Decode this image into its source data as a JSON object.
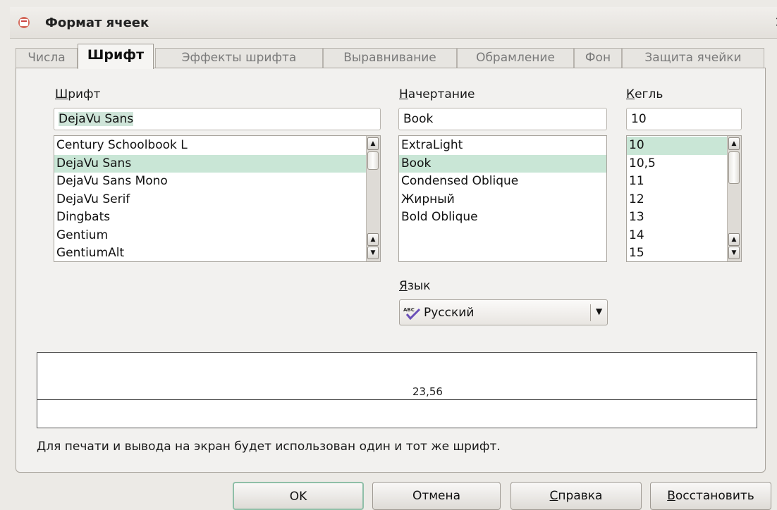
{
  "window": {
    "title": "Формат ячеек",
    "close_label": "×"
  },
  "tabs": [
    {
      "label": "Числа",
      "active": false
    },
    {
      "label": "Шрифт",
      "active": true
    },
    {
      "label": "Эффекты шрифта",
      "active": false
    },
    {
      "label": "Выравнивание",
      "active": false
    },
    {
      "label": "Обрамление",
      "active": false
    },
    {
      "label": "Фон",
      "active": false
    },
    {
      "label": "Защита ячейки",
      "active": false
    }
  ],
  "font": {
    "label_first": "Ш",
    "label_rest": "рифт",
    "value": "DejaVu Sans",
    "items": [
      "Century Schoolbook L",
      "DejaVu Sans",
      "DejaVu Sans Mono",
      "DejaVu Serif",
      "Dingbats",
      "Gentium",
      "GentiumAlt"
    ],
    "selected": "DejaVu Sans"
  },
  "style": {
    "label_first": "Н",
    "label_rest": "ачертание",
    "value": "Book",
    "items": [
      "ExtraLight",
      "Book",
      "Condensed Oblique",
      "Жирный",
      "Bold Oblique"
    ],
    "selected": "Book"
  },
  "size": {
    "label_first": "К",
    "label_rest": "егль",
    "value": "10",
    "items": [
      "10",
      "10,5",
      "11",
      "12",
      "13",
      "14",
      "15"
    ],
    "selected": "10"
  },
  "language": {
    "label_first": "Я",
    "label_rest": "зык",
    "value": "Русский",
    "icon": "spellcheck-abc-icon"
  },
  "preview": {
    "text": "23,56",
    "info": "Для печати и вывода на экран будет использован один и тот же шрифт."
  },
  "buttons": {
    "ok": "OK",
    "cancel": "Отмена",
    "help_first": "С",
    "help_rest": "правка",
    "reset_first": "В",
    "reset_rest": "осстановить"
  },
  "colors": {
    "selection": "#c9e6d6",
    "panel": "#f2f1ef"
  }
}
